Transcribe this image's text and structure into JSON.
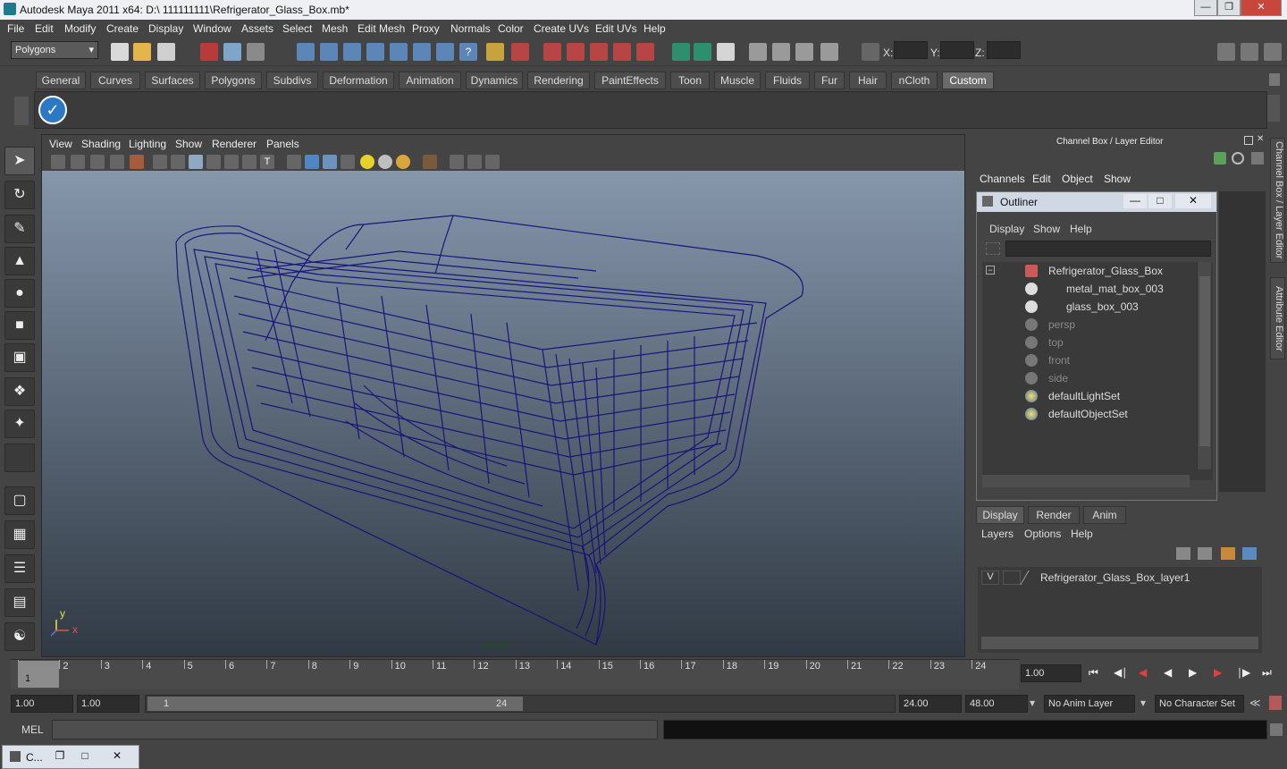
{
  "window": {
    "title": "Autodesk Maya 2011 x64: D:\\ 111111111\\Refrigerator_Glass_Box.mb*"
  },
  "menus": [
    "File",
    "Edit",
    "Modify",
    "Create",
    "Display",
    "Window",
    "Assets",
    "Select",
    "Mesh",
    "Edit Mesh",
    "Proxy",
    "Normals",
    "Color",
    "Create UVs",
    "Edit UVs",
    "Help"
  ],
  "status": {
    "mode": "Polygons",
    "x_label": "X:",
    "y_label": "Y:",
    "z_label": "Z:"
  },
  "shelf": {
    "tabs": [
      "General",
      "Curves",
      "Surfaces",
      "Polygons",
      "Subdivs",
      "Deformation",
      "Animation",
      "Dynamics",
      "Rendering",
      "PaintEffects",
      "Toon",
      "Muscle",
      "Fluids",
      "Fur",
      "Hair",
      "nCloth",
      "Custom"
    ],
    "active": "Custom"
  },
  "viewport": {
    "menus": [
      "View",
      "Shading",
      "Lighting",
      "Show",
      "Renderer",
      "Panels"
    ],
    "camera_label": "persp",
    "axis_y": "y",
    "axis_x": "x"
  },
  "channelbox": {
    "title": "Channel Box / Layer Editor",
    "menus": [
      "Channels",
      "Edit",
      "Object",
      "Show"
    ]
  },
  "outliner": {
    "title": "Outliner",
    "menus": [
      "Display",
      "Show",
      "Help"
    ],
    "items": [
      {
        "name": "Refrigerator_Glass_Box",
        "dim": false
      },
      {
        "name": "metal_mat_box_003",
        "dim": false
      },
      {
        "name": "glass_box_003",
        "dim": false
      },
      {
        "name": "persp",
        "dim": true
      },
      {
        "name": "top",
        "dim": true
      },
      {
        "name": "front",
        "dim": true
      },
      {
        "name": "side",
        "dim": true
      },
      {
        "name": "defaultLightSet",
        "dim": false
      },
      {
        "name": "defaultObjectSet",
        "dim": false
      }
    ]
  },
  "layereditor": {
    "tabs": [
      "Display",
      "Render",
      "Anim"
    ],
    "menus": [
      "Layers",
      "Options",
      "Help"
    ],
    "layer_visible": "V",
    "layer_name": "Refrigerator_Glass_Box_layer1"
  },
  "sidetabs": [
    "Channel Box / Layer Editor",
    "Attribute Editor"
  ],
  "timeline": {
    "ticks": [
      "1",
      "2",
      "3",
      "4",
      "5",
      "6",
      "7",
      "8",
      "9",
      "10",
      "11",
      "12",
      "13",
      "14",
      "15",
      "16",
      "17",
      "18",
      "19",
      "20",
      "21",
      "22",
      "23",
      "24"
    ],
    "current_frame_marker": "1",
    "current_time": "1.00"
  },
  "range": {
    "start": "1.00",
    "playback_start": "1.00",
    "slider_start": "1",
    "slider_end": "24",
    "playback_end": "24.00",
    "end": "48.00",
    "anim_layer": "No Anim Layer",
    "character_set": "No Character Set"
  },
  "cmdline": {
    "label": "MEL"
  },
  "taskbar": {
    "label": "C..."
  }
}
